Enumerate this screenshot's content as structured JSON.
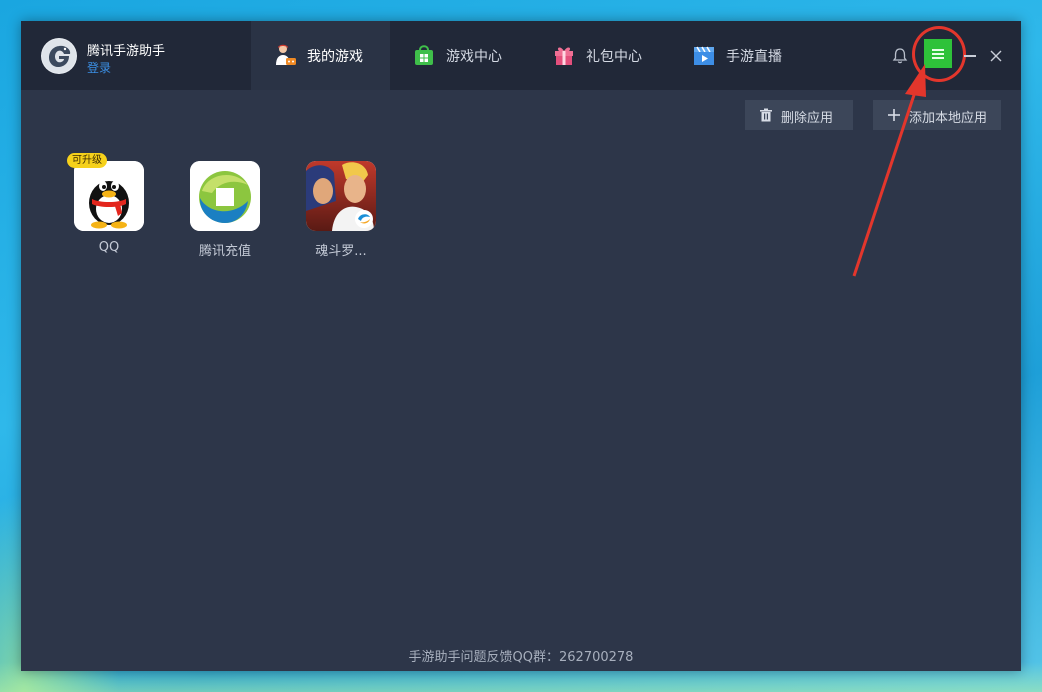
{
  "window": {
    "app_name": "腾讯手游助手",
    "login_label": "登录"
  },
  "tabs": [
    {
      "label": "我的游戏",
      "icon": "user-games-icon",
      "active": true
    },
    {
      "label": "游戏中心",
      "icon": "shop-bag-icon",
      "active": false
    },
    {
      "label": "礼包中心",
      "icon": "gift-icon",
      "active": false
    },
    {
      "label": "手游直播",
      "icon": "video-play-icon",
      "active": false
    }
  ],
  "controls": {
    "bell_icon": "bell-icon",
    "menu_icon": "hamburger-menu-icon",
    "minimize_icon": "minimize-icon",
    "close_icon": "close-icon"
  },
  "toolbar": {
    "delete_label": "删除应用",
    "add_label": "添加本地应用"
  },
  "apps": [
    {
      "name": "QQ",
      "badge": "可升级",
      "icon": "qq-penguin-icon"
    },
    {
      "name": "腾讯充值",
      "icon": "tencent-recharge-icon"
    },
    {
      "name": "魂斗罗...",
      "icon": "contra-game-icon"
    }
  ],
  "footer": {
    "text": "手游助手问题反馈QQ群：262700278"
  },
  "colors": {
    "accent_green": "#2ec23a",
    "highlight_red": "#e3362c",
    "link_blue": "#3b8fe4",
    "window_bg": "#2d3649",
    "titlebar_bg": "#212838"
  }
}
